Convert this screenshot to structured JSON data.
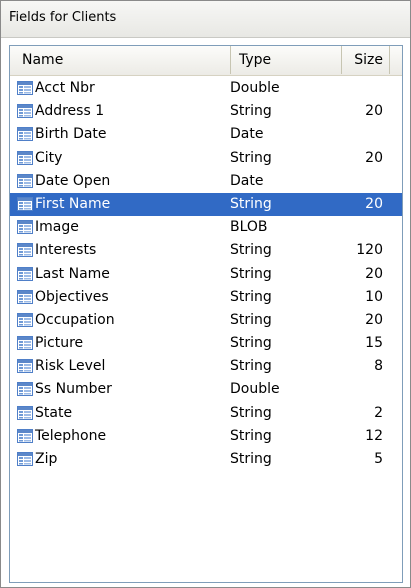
{
  "window": {
    "title": "Fields for Clients"
  },
  "columns": {
    "name": "Name",
    "type": "Type",
    "size": "Size"
  },
  "icon": "table-field-icon",
  "colors": {
    "selection": "#316ac5",
    "icon_blue": "#5b87c9"
  },
  "fields": [
    {
      "name": "Acct Nbr",
      "type": "Double",
      "size": ""
    },
    {
      "name": "Address 1",
      "type": "String",
      "size": "20"
    },
    {
      "name": "Birth Date",
      "type": "Date",
      "size": ""
    },
    {
      "name": "City",
      "type": "String",
      "size": "20"
    },
    {
      "name": "Date Open",
      "type": "Date",
      "size": ""
    },
    {
      "name": "First Name",
      "type": "String",
      "size": "20",
      "selected": true
    },
    {
      "name": "Image",
      "type": "BLOB",
      "size": ""
    },
    {
      "name": "Interests",
      "type": "String",
      "size": "120"
    },
    {
      "name": "Last Name",
      "type": "String",
      "size": "20"
    },
    {
      "name": "Objectives",
      "type": "String",
      "size": "10"
    },
    {
      "name": "Occupation",
      "type": "String",
      "size": "20"
    },
    {
      "name": "Picture",
      "type": "String",
      "size": "15"
    },
    {
      "name": "Risk Level",
      "type": "String",
      "size": "8"
    },
    {
      "name": "Ss Number",
      "type": "Double",
      "size": ""
    },
    {
      "name": "State",
      "type": "String",
      "size": "2"
    },
    {
      "name": "Telephone",
      "type": "String",
      "size": "12"
    },
    {
      "name": "Zip",
      "type": "String",
      "size": "5"
    }
  ]
}
